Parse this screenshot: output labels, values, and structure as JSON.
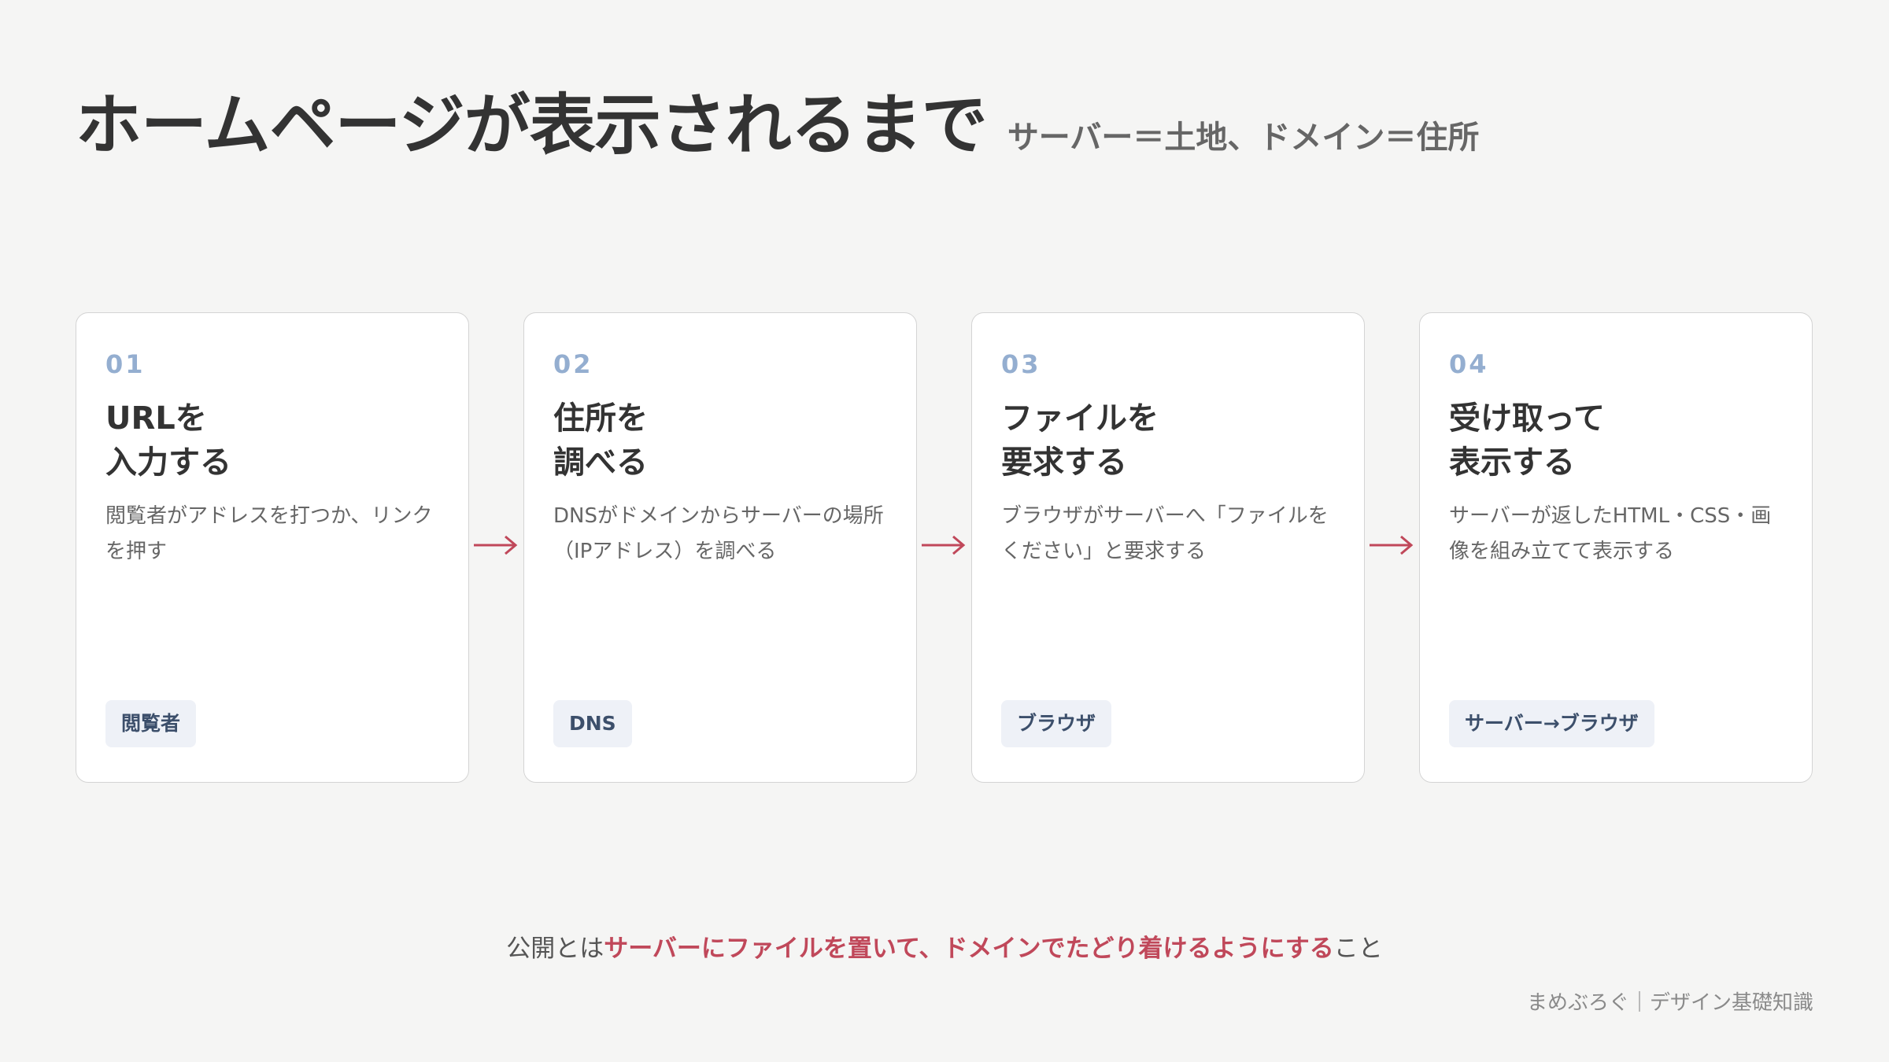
{
  "header": {
    "title": "ホームページが表示されるまで",
    "subtitle": "サーバー＝土地、ドメイン＝住所"
  },
  "steps": [
    {
      "number": "01",
      "heading": "URLを\n入力する",
      "description": "閲覧者がアドレスを打つか、リンクを押す",
      "tag": "閲覧者"
    },
    {
      "number": "02",
      "heading": "住所を\n調べる",
      "description": "DNSがドメインからサーバーの場所（IPアドレス）を調べる",
      "tag": "DNS"
    },
    {
      "number": "03",
      "heading": "ファイルを\n要求する",
      "description": "ブラウザがサーバーへ「ファイルをください」と要求する",
      "tag": "ブラウザ"
    },
    {
      "number": "04",
      "heading": "受け取って\n表示する",
      "description": "サーバーが返したHTML・CSS・画像を組み立てて表示する",
      "tag": "サーバー→ブラウザ"
    }
  ],
  "footer": {
    "prefix": "公開とは",
    "emphasis": "サーバーにファイルを置いて、ドメインでたどり着けるようにする",
    "suffix": "こと"
  },
  "credit": "まめぶろぐ｜デザイン基礎知識",
  "colors": {
    "background": "#f5f5f4",
    "accent": "#c0485a",
    "step_number": "#94aed0",
    "tag_background": "#eef1f7",
    "tag_text": "#3c4f6b"
  }
}
